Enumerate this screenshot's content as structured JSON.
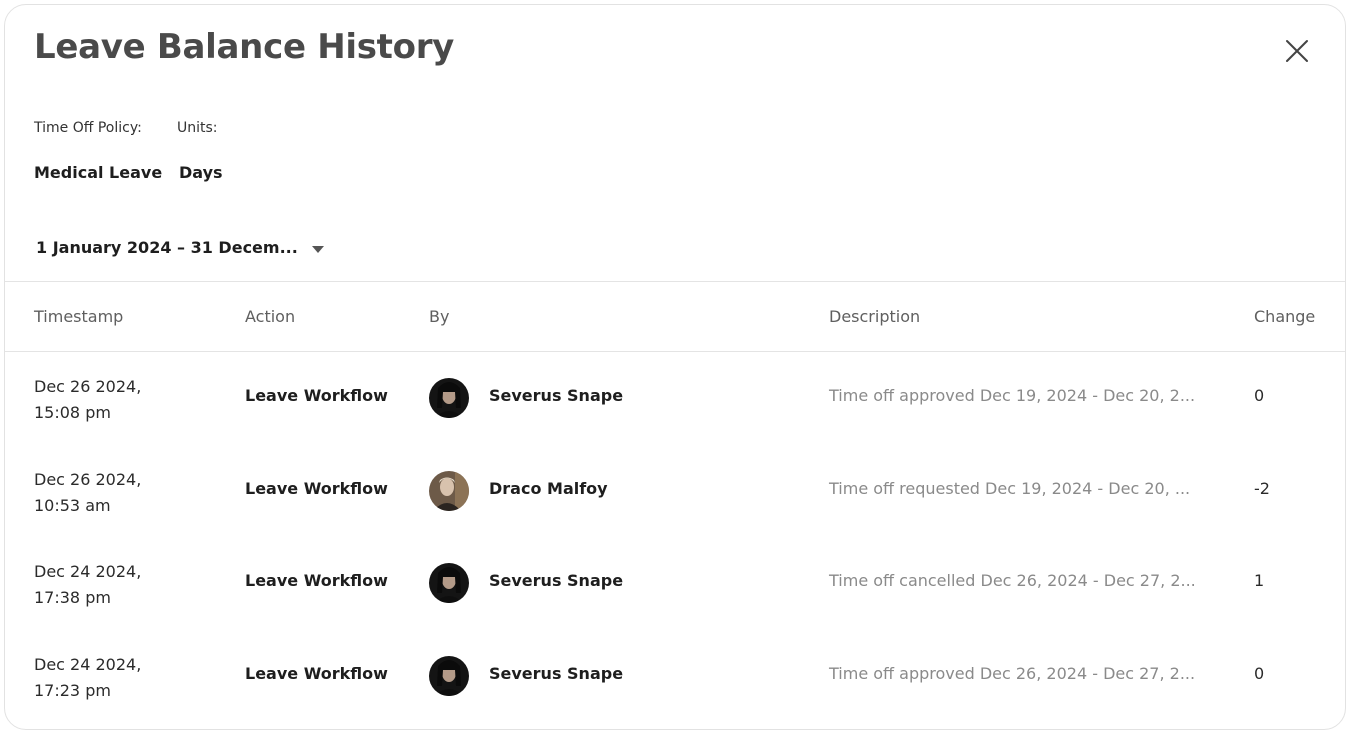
{
  "modal": {
    "title": "Leave Balance History"
  },
  "meta": {
    "policy_label": "Time Off Policy:",
    "policy_value": "Medical Leave",
    "units_label": "Units:",
    "units_value": "Days"
  },
  "date_range": {
    "value": "1 January 2024 – 31 Decem..."
  },
  "table": {
    "headers": {
      "timestamp": "Timestamp",
      "action": "Action",
      "by": "By",
      "description": "Description",
      "change": "Change"
    },
    "rows": [
      {
        "date": "Dec 26 2024,",
        "time": "15:08 pm",
        "action": "Leave Workflow",
        "by": "Severus Snape",
        "avatar": "severus-avatar",
        "description": "Time off approved Dec 19, 2024 - Dec 20, 2...",
        "change": "0"
      },
      {
        "date": "Dec 26 2024,",
        "time": "10:53 am",
        "action": "Leave Workflow",
        "by": "Draco Malfoy",
        "avatar": "draco-avatar",
        "description": "Time off requested Dec 19, 2024 - Dec 20, ...",
        "change": "-2"
      },
      {
        "date": "Dec 24 2024,",
        "time": "17:38 pm",
        "action": "Leave Workflow",
        "by": "Severus Snape",
        "avatar": "severus-avatar",
        "description": "Time off cancelled Dec 26, 2024 - Dec 27, 2...",
        "change": "1"
      },
      {
        "date": "Dec 24 2024,",
        "time": "17:23 pm",
        "action": "Leave Workflow",
        "by": "Severus Snape",
        "avatar": "severus-avatar",
        "description": "Time off approved Dec 26, 2024 - Dec 27, 2...",
        "change": "0"
      }
    ]
  },
  "icons": {
    "close": "close-icon",
    "dropdown": "chevron-down-icon"
  },
  "colors": {
    "title": "#4a4a4a",
    "text": "#1e1e1e",
    "muted": "#8a8a8a",
    "header_text": "#5f5f5f",
    "divider": "#e4e4e4"
  }
}
